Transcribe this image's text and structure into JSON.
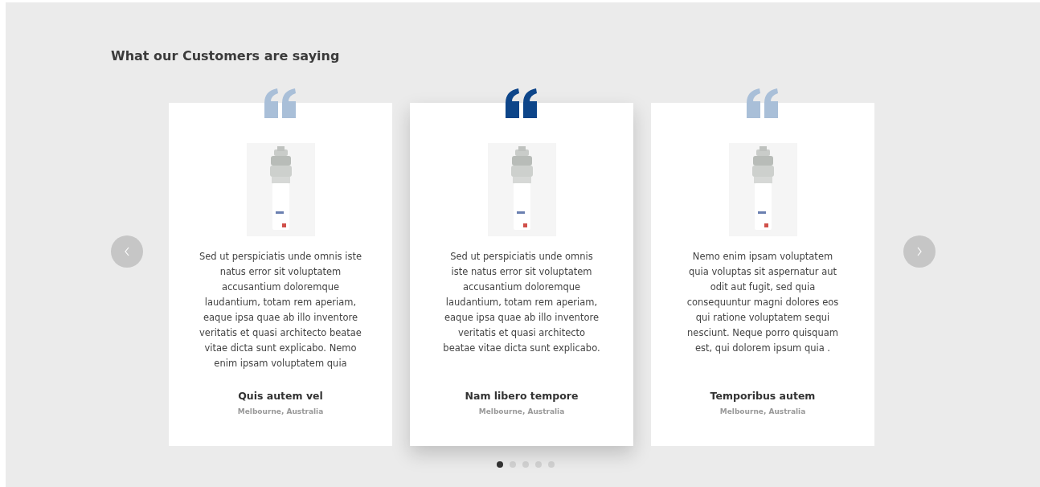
{
  "heading": "What our Customers are saying",
  "testimonials": [
    {
      "quote": "Sed ut perspiciatis unde omnis iste natus error sit voluptatem accusantium doloremque laudantium, totam rem aperiam, eaque ipsa quae ab illo inventore veritatis et quasi architecto beatae vitae dicta sunt explicabo. Nemo enim ipsam voluptatem quia",
      "name": "Quis autem vel",
      "location": "Melbourne, Australia",
      "selected": false
    },
    {
      "quote": "Sed ut perspiciatis unde omnis iste natus error sit voluptatem accusantium doloremque laudantium, totam rem aperiam, eaque ipsa quae ab illo inventore veritatis et quasi architecto beatae vitae dicta sunt explicabo.",
      "name": "Nam libero tempore",
      "location": "Melbourne, Australia",
      "selected": true
    },
    {
      "quote": "Nemo enim ipsam voluptatem quia voluptas sit aspernatur aut odit aut fugit, sed quia consequuntur magni dolores eos qui ratione voluptatem sequi nesciunt. Neque porro quisquam est, qui dolorem ipsum quia .",
      "name": "Temporibus autem",
      "location": "Melbourne, Australia",
      "selected": false
    }
  ],
  "pagination": [
    {
      "selected": true
    },
    {
      "selected": false
    },
    {
      "selected": false
    },
    {
      "selected": false
    },
    {
      "selected": false
    }
  ]
}
